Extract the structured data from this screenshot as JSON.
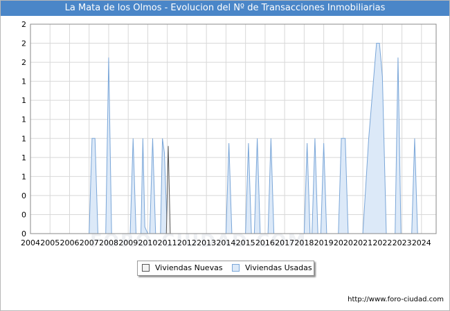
{
  "title": "La Mata de los Olmos - Evolucion del Nº de Transacciones Inmobiliarias",
  "watermark": "FORO-CIUDAD.COM",
  "credit": "http://www.foro-ciudad.com",
  "legend": {
    "nuevas": "Viviendas Nuevas",
    "usadas": "Viviendas Usadas"
  },
  "colors": {
    "header": "#4a86c8",
    "usadas_fill": "#dce9f8",
    "usadas_stroke": "#7aa6d8",
    "nuevas_fill": "#f2f2f2",
    "nuevas_stroke": "#555555",
    "grid": "#d8d8d8"
  },
  "chart_data": {
    "type": "area",
    "x_tick_labels": [
      "2004",
      "2005",
      "2006",
      "2007",
      "2008",
      "2009",
      "2010",
      "2011",
      "2012",
      "2013",
      "2014",
      "2015",
      "2016",
      "2017",
      "2018",
      "2019",
      "2020",
      "2021",
      "2022",
      "2023",
      "2024"
    ],
    "y_tick_labels": [
      "0",
      "0",
      "0",
      "1",
      "1",
      "1",
      "1",
      "1",
      "1",
      "2",
      "2",
      "2"
    ],
    "ylim": [
      0,
      2.2
    ],
    "grid": true,
    "legend_position": "bottom",
    "series": [
      {
        "name": "Viviendas Usadas",
        "points": [
          [
            2007.0,
            0
          ],
          [
            2007.15,
            1
          ],
          [
            2007.3,
            1
          ],
          [
            2007.45,
            0
          ],
          [
            2007.85,
            0
          ],
          [
            2008.0,
            1.85
          ],
          [
            2008.15,
            0
          ],
          [
            2009.1,
            0
          ],
          [
            2009.25,
            1
          ],
          [
            2009.4,
            0
          ],
          [
            2009.65,
            0
          ],
          [
            2009.75,
            1
          ],
          [
            2009.85,
            0.07
          ],
          [
            2010.0,
            0
          ],
          [
            2010.1,
            0
          ],
          [
            2010.25,
            1
          ],
          [
            2010.4,
            0
          ],
          [
            2010.65,
            0
          ],
          [
            2010.75,
            1
          ],
          [
            2010.85,
            0.85
          ],
          [
            2011.0,
            0
          ],
          [
            2014.0,
            0
          ],
          [
            2014.15,
            0.95
          ],
          [
            2014.3,
            0
          ],
          [
            2015.0,
            0
          ],
          [
            2015.15,
            0.95
          ],
          [
            2015.3,
            0
          ],
          [
            2015.45,
            0
          ],
          [
            2015.6,
            1
          ],
          [
            2015.75,
            0
          ],
          [
            2016.15,
            0
          ],
          [
            2016.3,
            1
          ],
          [
            2016.45,
            0
          ],
          [
            2018.0,
            0
          ],
          [
            2018.15,
            0.95
          ],
          [
            2018.3,
            0
          ],
          [
            2018.4,
            0
          ],
          [
            2018.55,
            1
          ],
          [
            2018.7,
            0
          ],
          [
            2018.85,
            0
          ],
          [
            2019.0,
            0.95
          ],
          [
            2019.15,
            0
          ],
          [
            2019.75,
            0
          ],
          [
            2019.9,
            1
          ],
          [
            2020.1,
            1
          ],
          [
            2020.25,
            0
          ],
          [
            2021.0,
            0
          ],
          [
            2021.3,
            1
          ],
          [
            2021.7,
            2.0
          ],
          [
            2021.85,
            2.0
          ],
          [
            2022.0,
            1.65
          ],
          [
            2022.2,
            0
          ],
          [
            2022.65,
            0
          ],
          [
            2022.8,
            1.85
          ],
          [
            2022.95,
            0
          ],
          [
            2023.5,
            0
          ],
          [
            2023.65,
            1
          ],
          [
            2023.8,
            0
          ]
        ]
      },
      {
        "name": "Viviendas Nuevas",
        "points": [
          [
            2010.95,
            0
          ],
          [
            2011.05,
            0.92
          ],
          [
            2011.15,
            0
          ]
        ]
      }
    ]
  }
}
